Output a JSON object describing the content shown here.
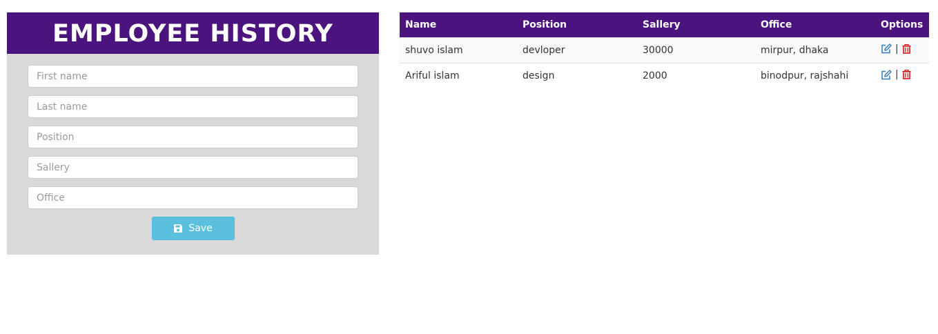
{
  "form": {
    "title": "EMPLOYEE HISTORY",
    "fields": [
      {
        "name": "first-name-field",
        "placeholder": "First name"
      },
      {
        "name": "last-name-field",
        "placeholder": "Last name"
      },
      {
        "name": "position-field",
        "placeholder": "Position"
      },
      {
        "name": "sallery-field",
        "placeholder": "Sallery"
      },
      {
        "name": "office-field",
        "placeholder": "Office"
      }
    ],
    "save_label": "Save",
    "save_icon": "floppy-disk-icon"
  },
  "table": {
    "headers": [
      "Name",
      "Position",
      "Sallery",
      "Office",
      "Options"
    ],
    "rows": [
      {
        "name": "shuvo islam",
        "position": "devloper",
        "sallery": "30000",
        "office": "mirpur, dhaka"
      },
      {
        "name": "Ariful islam",
        "position": "design",
        "sallery": "2000",
        "office": "binodpur, rajshahi"
      }
    ],
    "separator": "|",
    "edit_icon": "edit-icon",
    "delete_icon": "trash-icon"
  },
  "colors": {
    "header_purple": "#4a137d",
    "form_background": "#d9d9d9",
    "save_button": "#5bc0de",
    "edit_icon": "#337ab7",
    "delete_icon": "#d9000d"
  }
}
